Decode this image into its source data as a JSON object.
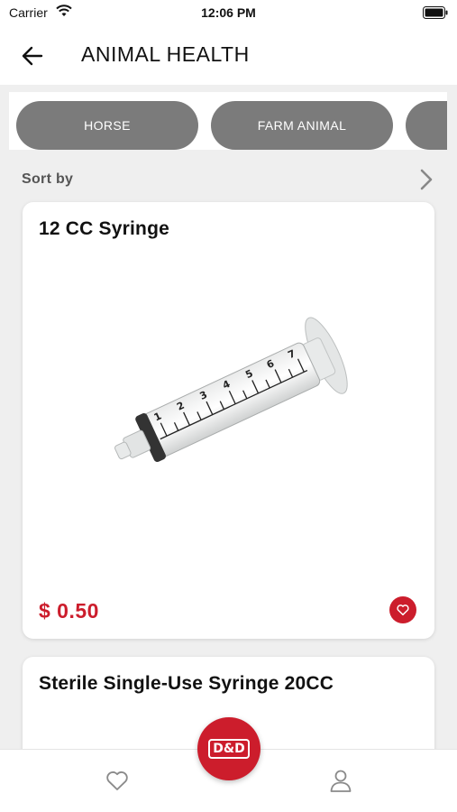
{
  "status_bar": {
    "carrier": "Carrier",
    "time": "12:06 PM"
  },
  "header": {
    "title": "ANIMAL HEALTH",
    "back_icon": "arrow-left-icon"
  },
  "categories": [
    {
      "label": "HORSE"
    },
    {
      "label": "FARM ANIMAL"
    },
    {
      "label": ""
    }
  ],
  "sort": {
    "label": "Sort by",
    "icon": "chevron-right-icon"
  },
  "products": [
    {
      "name": "12 CC Syringe",
      "price": "$ 0.50",
      "image": "syringe"
    },
    {
      "name": "Sterile Single-Use Syringe 20CC",
      "price": "",
      "image": "syringe"
    }
  ],
  "tabbar": {
    "items": [
      {
        "icon": "heart-icon"
      },
      {
        "icon": "logo"
      },
      {
        "icon": "user-icon"
      }
    ],
    "logo_text": "D&D"
  },
  "colors": {
    "accent": "#cc1d2c",
    "chip": "#7b7b7b",
    "background": "#efefef"
  }
}
